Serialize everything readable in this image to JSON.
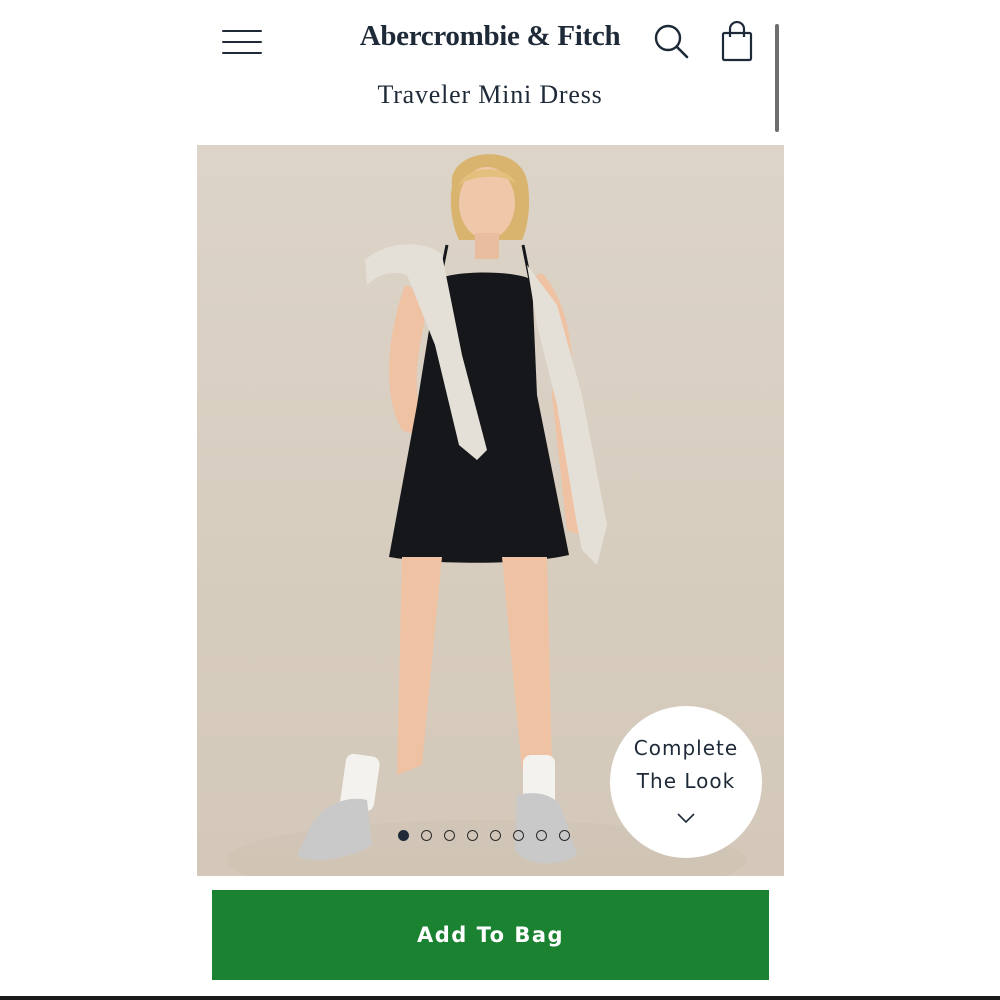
{
  "header": {
    "brand": "Abercrombie & Fitch",
    "product_title": "Traveler Mini Dress",
    "icons": [
      "hamburger-menu-icon",
      "search-icon",
      "shopping-bag-icon"
    ]
  },
  "gallery": {
    "image_count": 8,
    "active_index": 0,
    "complete_look": {
      "line1": "Complete",
      "line2": "The Look",
      "icon": "chevron-down-icon"
    }
  },
  "actions": {
    "add_to_bag_label": "Add To Bag"
  },
  "colors": {
    "text": "#1f2a38",
    "accent_green": "#1b8232",
    "image_background": "#d9d0c4"
  }
}
